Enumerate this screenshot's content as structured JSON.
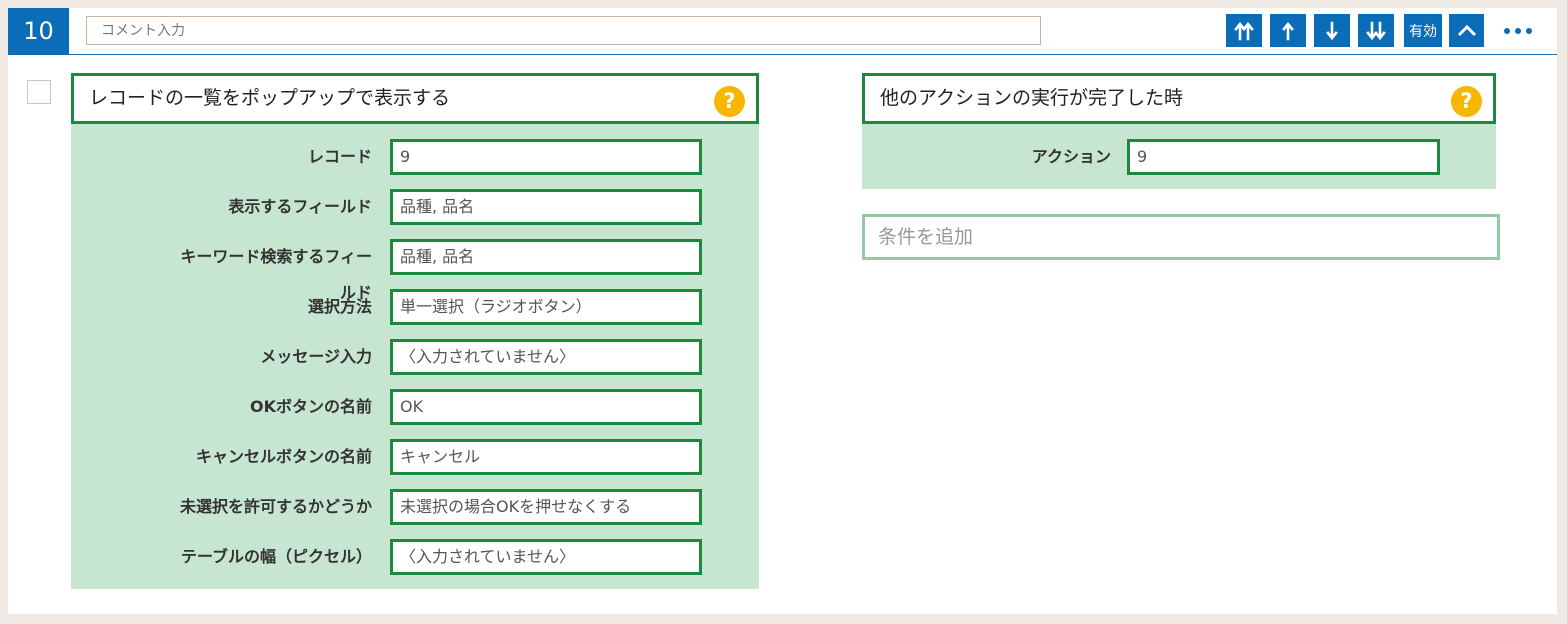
{
  "step": {
    "number": "10"
  },
  "comment": {
    "placeholder": "コメント入力",
    "value": ""
  },
  "toolbar": {
    "move_top_icon": "double-arrow-up-icon",
    "move_up_icon": "arrow-up-icon",
    "move_down_icon": "arrow-down-icon",
    "move_bottom_icon": "double-arrow-down-icon",
    "enabled_label": "有効",
    "collapse_icon": "chevron-up-icon",
    "more_icon": "more-horizontal-icon"
  },
  "action_panel": {
    "title": "レコードの一覧をポップアップで表示する",
    "help": "?",
    "fields": [
      {
        "label": "レコード",
        "value": "9"
      },
      {
        "label": "表示するフィールド",
        "value": "品種, 品名"
      },
      {
        "label": "キーワード検索するフィールド",
        "value": "品種, 品名"
      },
      {
        "label": "選択方法",
        "value": "単一選択（ラジオボタン）"
      },
      {
        "label": "メッセージ入力",
        "value": "〈入力されていません〉"
      },
      {
        "label": "OKボタンの名前",
        "value": "OK"
      },
      {
        "label": "キャンセルボタンの名前",
        "value": "キャンセル"
      },
      {
        "label": "未選択を許可するかどうか",
        "value": "未選択の場合OKを押せなくする"
      },
      {
        "label": "テーブルの幅（ピクセル）",
        "value": "〈入力されていません〉"
      }
    ]
  },
  "condition_panel": {
    "title": "他のアクションの実行が完了した時",
    "help": "?",
    "fields": [
      {
        "label": "アクション",
        "value": "9"
      }
    ],
    "add_condition_label": "条件を追加"
  },
  "colors": {
    "primary_blue": "#0b6cb8",
    "green_border": "#1b8a3f",
    "green_fill": "#c6e6d1",
    "help_yellow": "#f6b700"
  }
}
